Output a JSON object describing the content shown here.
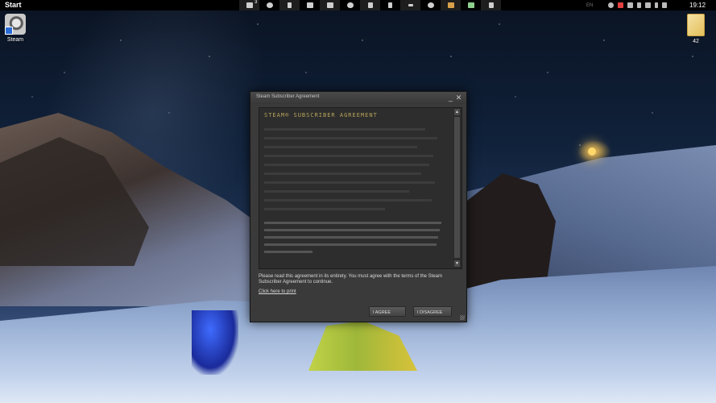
{
  "taskbar": {
    "start_label": "Start",
    "icons": [
      {
        "name": "file-explorer-icon",
        "badge": "3"
      },
      {
        "name": "refresh-icon"
      },
      {
        "name": "plug-icon"
      },
      {
        "name": "folder-icon"
      },
      {
        "name": "folder-icon-2"
      },
      {
        "name": "cloud-icon"
      },
      {
        "name": "chart-icon"
      },
      {
        "name": "storage-icon"
      },
      {
        "name": "pen-icon"
      },
      {
        "name": "steam-icon"
      },
      {
        "name": "image-icon"
      },
      {
        "name": "monitor-icon"
      },
      {
        "name": "document-icon"
      }
    ],
    "tray": {
      "language": "EN"
    },
    "clock": "19:12"
  },
  "desktop": {
    "steam_label": "Steam",
    "folder_label": "42"
  },
  "dialog": {
    "title": "Steam Subscriber Agreement",
    "minimize_glyph": "_",
    "close_glyph": "✕",
    "agreement_heading": "STEAM® SUBSCRIBER AGREEMENT",
    "instruction": "Please read this agreement in its entirety. You must agree with the terms of the Steam Subscriber Agreement to continue.",
    "print_link": "Click here to print",
    "agree_label": "I AGREE",
    "disagree_label": "I DISAGREE",
    "scroll_up_glyph": "▲",
    "scroll_down_glyph": "▼"
  },
  "colors": {
    "dialog_bg": "#3a3a3a",
    "heading": "#b7a35b",
    "taskbar": "#000000"
  }
}
